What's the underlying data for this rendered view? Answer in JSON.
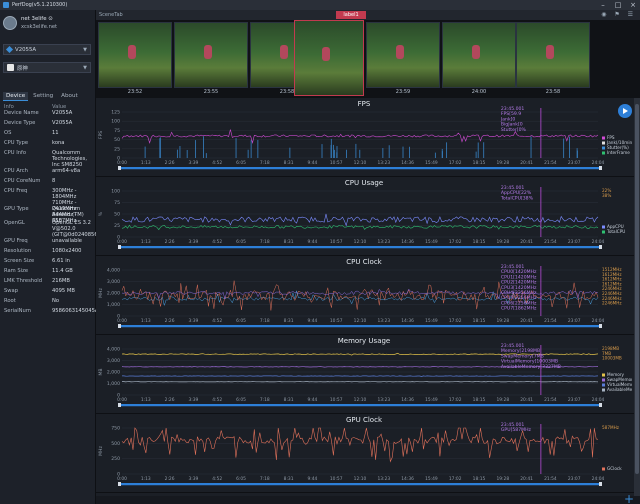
{
  "window": {
    "title": "PerfDog(v5.1.210300)",
    "minimize": "–",
    "maximize": "□",
    "close": "×"
  },
  "user": {
    "name": "net 3elife ⊙",
    "email": "xcsk3elife.net"
  },
  "device_select": {
    "value": "V2055A"
  },
  "app_select": {
    "value": "原神"
  },
  "sidebar_tabs": [
    "Device",
    "Setting",
    "About"
  ],
  "info_header": {
    "key": "Info",
    "value": "Value"
  },
  "device_info": [
    {
      "k": "Device Name",
      "v": "V2055A"
    },
    {
      "k": "Device Type",
      "v": "V2055A"
    },
    {
      "k": "OS",
      "v": "11"
    },
    {
      "k": "CPU Type",
      "v": "kona"
    },
    {
      "k": "CPU Info",
      "v": "Qualcomm Technologies, Inc SM8250"
    },
    {
      "k": "CPU Arch",
      "v": "arm64-v8a"
    },
    {
      "k": "CPU CoreNum",
      "v": "8"
    },
    {
      "k": "CPU Freq",
      "v": "300MHz - 1804MHz 710MHz - 2419MHz 844MHz - 3187MHz"
    },
    {
      "k": "GPU Type",
      "v": "Qualcomm Adreno (TM) 650"
    },
    {
      "k": "OpenGL",
      "v": "OpenGL ES 3.2 V@502.0 (GIT@0d0240856a)"
    },
    {
      "k": "GPU Freq",
      "v": "unavailable"
    },
    {
      "k": "Resolution",
      "v": "1080x2400"
    },
    {
      "k": "Screen Size",
      "v": "6.61 in"
    },
    {
      "k": "Ram Size",
      "v": "11.4 GB"
    },
    {
      "k": "LMK Threshold",
      "v": "216MB"
    },
    {
      "k": "Swap",
      "v": "4095 MB"
    },
    {
      "k": "Root",
      "v": "No"
    },
    {
      "k": "SerialNum",
      "v": "9586063145045A"
    }
  ],
  "scene": {
    "tab_label": "SceneTab",
    "label_chip": "label1"
  },
  "thumbnails": [
    "23:52",
    "23:55",
    "23:58",
    "23:57",
    "23:59",
    "24:00",
    "23:58"
  ],
  "time_ticks": [
    "0:00",
    "0:40",
    "1:13",
    "1:53",
    "2:26",
    "3:06",
    "3:39",
    "4:19",
    "4:52",
    "5:32",
    "6:05",
    "6:45",
    "7:18",
    "7:58",
    "8:31",
    "9:11",
    "9:44",
    "10:24",
    "10:57",
    "11:37",
    "12:10",
    "12:50",
    "13:23",
    "14:03",
    "14:36",
    "15:16",
    "15:49",
    "16:29",
    "17:02",
    "17:42",
    "18:15",
    "18:55",
    "19:28",
    "20:08",
    "20:41",
    "21:21",
    "21:54",
    "22:34",
    "23:07",
    "23:47",
    "24:04"
  ],
  "colors": {
    "accent": "#2d7fd8",
    "fps": "#d24bd6",
    "jank": "#3b8ed8",
    "cpu_app": "#7b8cff",
    "cpu_total": "#2fbf71",
    "cpu_clock": "#e2725b",
    "memory": "#e3c34a",
    "gpu": "#e2725b",
    "label": "#c23a4f"
  },
  "charts": [
    {
      "title": "FPS",
      "ylabel": "FPS",
      "yticks": [
        "0",
        "25",
        "50",
        "75",
        "100",
        "125"
      ],
      "readout": [
        "23:45.001",
        "FPS[59.9",
        "Jank[0",
        "BigJank[0",
        "Stutter[0%"
      ],
      "legend": [
        "FPS",
        "Jank(/10min)",
        "Stutter(%)",
        "InterFrame"
      ]
    },
    {
      "title": "CPU Usage",
      "ylabel": "%",
      "yticks": [
        "0",
        "25",
        "50",
        "75",
        "100"
      ],
      "readout": [
        "23:45.001",
        "AppCPU[22%",
        "TotalCPU[38%"
      ],
      "legend": [
        "AppCPU",
        "TotalCPU"
      ],
      "values": [
        "22%",
        "38%"
      ]
    },
    {
      "title": "CPU Clock",
      "ylabel": "MHz",
      "yticks": [
        "0",
        "1,000",
        "2,000",
        "3,000",
        "4,000"
      ],
      "readout": [
        "23:45.001",
        "CPU0[1420MHz",
        "CPU1[1420MHz",
        "CPU2[1420MHz",
        "CPU3[1420MHz",
        "CPU4[2256MHz",
        "CPU5[2256MHz",
        "CPU6[2256MHz",
        "CPU7[1862MHz"
      ],
      "values": [
        "1512MHz",
        "1612MHz",
        "1612MHz",
        "1612MHz",
        "2246MHz",
        "2246MHz",
        "2246MHz",
        "2246MHz"
      ]
    },
    {
      "title": "Memory Usage",
      "ylabel": "MB",
      "yticks": [
        "0",
        "1,000",
        "2,000",
        "3,000",
        "4,000"
      ],
      "readout": [
        "23:45.001",
        "Memory[2198MB",
        "SwapMemory[7MB",
        "VirtualMemory[10003MB",
        "AvailableMemory[3327MB"
      ],
      "values": [
        "2198MB",
        "7MB",
        "10003MB"
      ],
      "legend": [
        "Memory",
        "SwapMemory",
        "VirtualMemory",
        "AvailableMemory"
      ]
    },
    {
      "title": "GPU Clock",
      "ylabel": "MHz",
      "yticks": [
        "0",
        "250",
        "500",
        "750"
      ],
      "readout": [
        "23:45.001",
        "GPU[587MHz"
      ],
      "values": [
        "587MHz"
      ],
      "legend": [
        "GClock"
      ]
    }
  ]
}
